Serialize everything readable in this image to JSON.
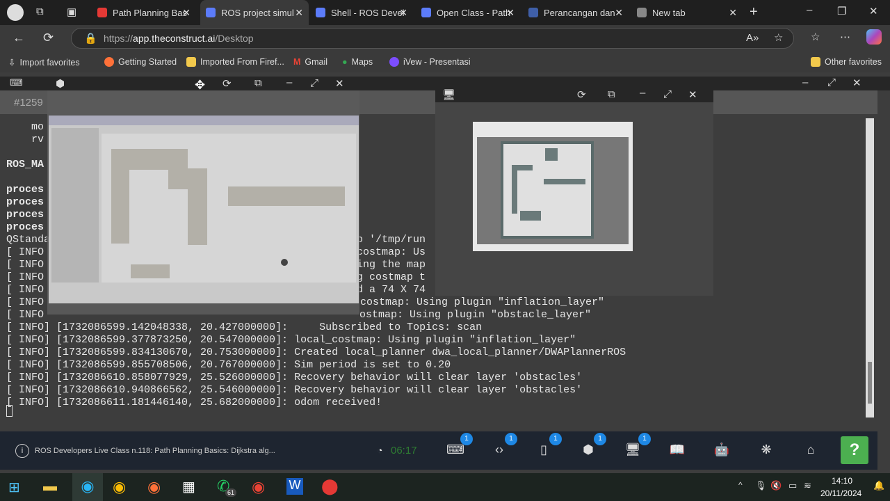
{
  "browser": {
    "tabs": [
      {
        "label": "Path Planning Bas",
        "color": "#e53935"
      },
      {
        "label": "ROS project simul",
        "color": "#5c7cfa",
        "active": true
      },
      {
        "label": "Shell - ROS Devel",
        "color": "#5c7cfa"
      },
      {
        "label": "Open Class - Path",
        "color": "#5c7cfa"
      },
      {
        "label": "Perancangan dan",
        "color": "#3f5fa8"
      },
      {
        "label": "New tab",
        "color": "#888"
      }
    ],
    "url_prefix": "https://",
    "url_host": "app.theconstruct.ai",
    "url_path": "/Desktop",
    "bookmarks": [
      "Import favorites",
      "Getting Started",
      "Imported From Firef...",
      "Gmail",
      "Maps",
      "iVew - Presentasi"
    ],
    "other_favorites": "Other favorites"
  },
  "terminal": {
    "header": "#1259",
    "left_lines": [
      {
        "t": "    mo",
        "b": false
      },
      {
        "t": "    rv",
        "b": false
      },
      {
        "t": "ROS_MA",
        "b": true
      },
      {
        "t": "proces",
        "b": true
      },
      {
        "t": "proces",
        "b": true
      },
      {
        "t": "proces",
        "b": true
      },
      {
        "t": "proces",
        "b": true
      },
      {
        "t": "QStanda",
        "b": false
      },
      {
        "t": "[ INFO",
        "b": false
      },
      {
        "t": "[ INFO",
        "b": false
      },
      {
        "t": "[ INFO",
        "b": false
      },
      {
        "t": "[ INFO",
        "b": false
      },
      {
        "t": "[ INFO",
        "b": false
      },
      {
        "t": "[ INFO",
        "b": false
      }
    ],
    "right_fragments": [
      "o '/tmp/run",
      "costmap: Us",
      "ing the map",
      "g costmap t",
      "d a 74 X 74",
      "costmap: Using plugin \"inflation_layer\"",
      "ostmap: Using plugin \"obstacle_layer\""
    ],
    "full_lines": [
      "[ INFO] [1732086599.142048338, 20.427000000]:     Subscribed to Topics: scan",
      "[ INFO] [1732086599.377873250, 20.547000000]: local_costmap: Using plugin \"inflation_layer\"",
      "[ INFO] [1732086599.834130670, 20.753000000]: Created local_planner dwa_local_planner/DWAPlannerROS",
      "[ INFO] [1732086599.855708506, 20.767000000]: Sim period is set to 0.20",
      "[ INFO] [1732086610.858077929, 25.526000000]: Recovery behavior will clear layer 'obstacles'",
      "[ INFO] [1732086610.940866562, 25.546000000]: Recovery behavior will clear layer 'obstacles'",
      "[ INFO] [1732086611.181446140, 25.682000000]: odom received!"
    ]
  },
  "toolbar": {
    "title": "ROS Developers Live Class n.118: Path Planning Basics: Dijkstra alg...",
    "timer": "06:17",
    "badge": "1",
    "help": "?"
  },
  "taskbar": {
    "whatsapp_badge": "61",
    "time": "14:10",
    "date": "20/11/2024"
  }
}
